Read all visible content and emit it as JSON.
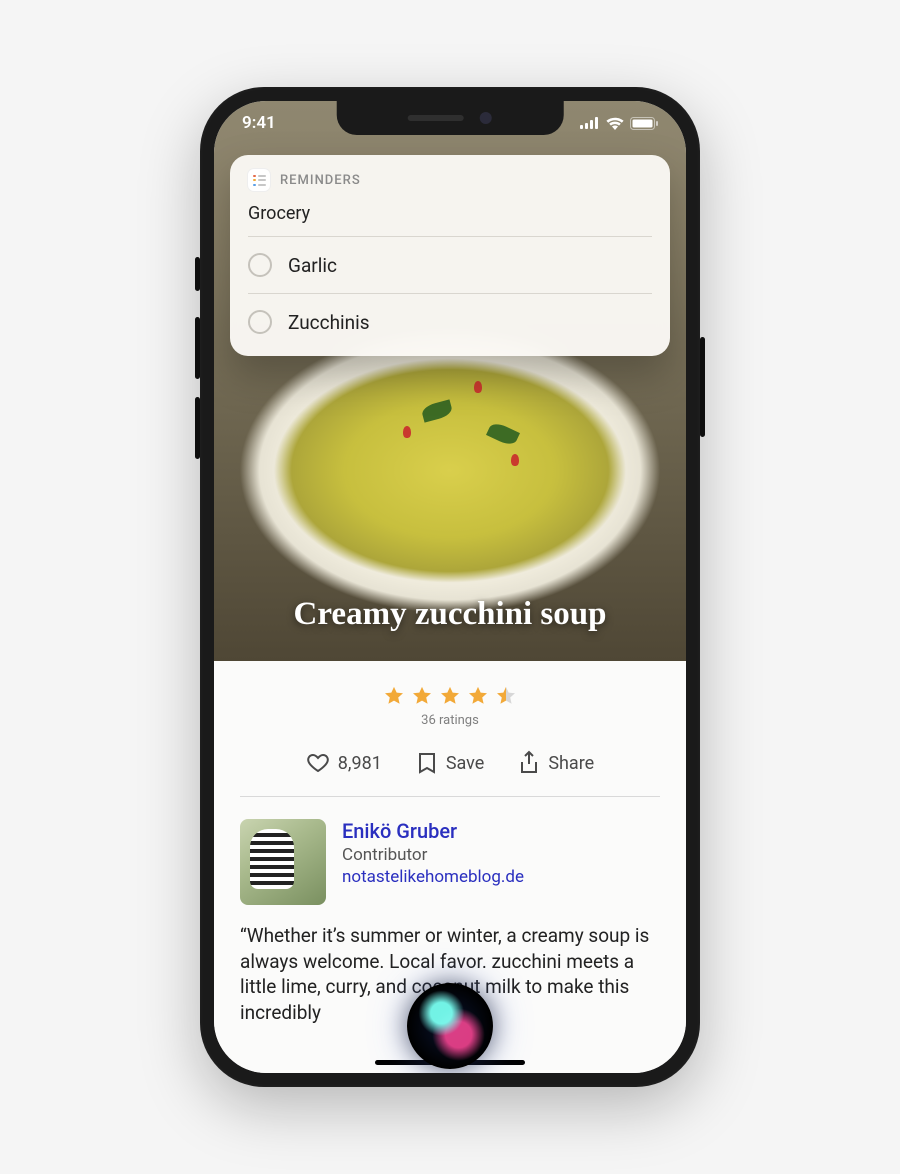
{
  "status": {
    "time": "9:41"
  },
  "reminders": {
    "app_label": "REMINDERS",
    "list_title": "Grocery",
    "items": [
      "Garlic",
      "Zucchinis"
    ]
  },
  "recipe": {
    "title": "Creamy zucchini soup",
    "rating_stars": 4.5,
    "ratings_label": "36 ratings",
    "likes": "8,981",
    "save_label": "Save",
    "share_label": "Share",
    "author": {
      "name": "Enikö Gruber",
      "role": "Contributor",
      "site": "notastelikehomeblog.de"
    },
    "description": "“Whether it’s summer or winter, a creamy soup is always welcome. Local favor.  zucchini meets a little lime, curry, and coconut milk to make this incredibly"
  }
}
